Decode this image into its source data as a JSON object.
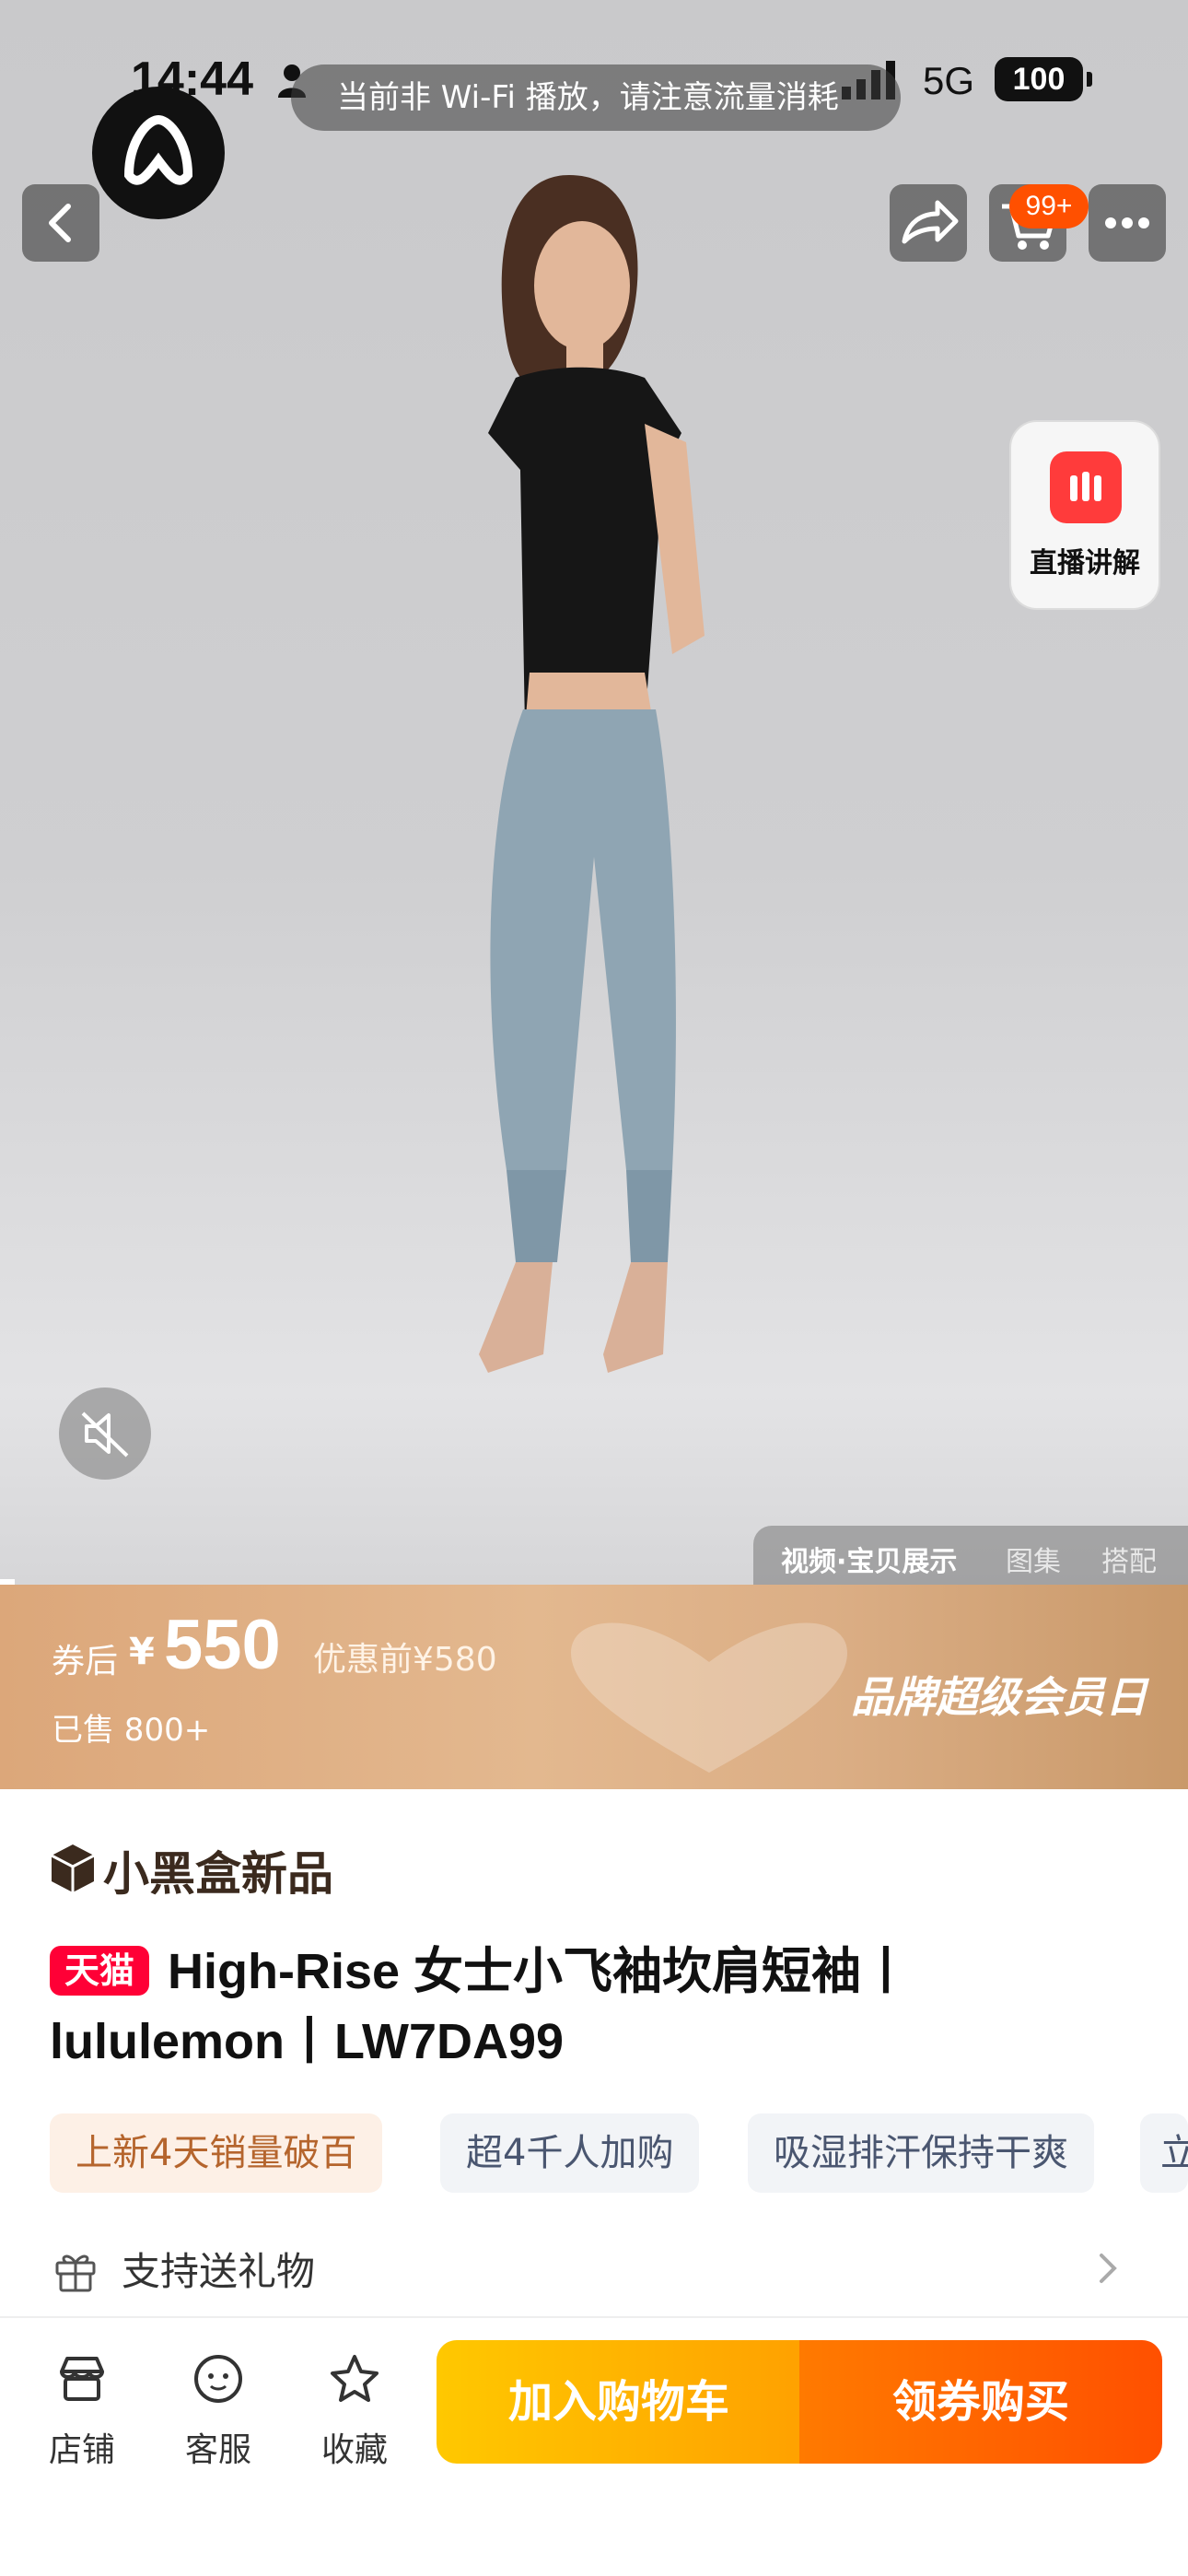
{
  "status_bar": {
    "time": "14:44",
    "network": "5G",
    "battery": "100"
  },
  "toast": {
    "text": "当前非 Wi-Fi 播放，请注意流量消耗"
  },
  "header": {
    "cart_badge": "99+"
  },
  "live": {
    "label": "直播讲解"
  },
  "media_tabs": [
    "视频·宝贝展示",
    "图集",
    "搭配"
  ],
  "price_banner": {
    "coupon_after_label": "券后",
    "currency": "¥",
    "price": "550",
    "price_before": "优惠前¥580",
    "sold": "已售 800+",
    "campaign": "品牌超级会员日",
    "colors": {
      "banner_start": "#dca77a",
      "banner_end": "#c9996a"
    }
  },
  "product": {
    "tag": "小黑盒新品",
    "platform_badge": "天猫",
    "title": "High-Rise 女士小飞袖坎肩短袖丨lululemon丨LW7DA99",
    "chips": [
      "上新4天销量破百",
      "超4千人加购",
      "吸湿排汗保持干爽",
      "立"
    ]
  },
  "gift": {
    "label": "支持送礼物"
  },
  "bottom_bar": {
    "nav": [
      "店铺",
      "客服",
      "收藏"
    ],
    "add_to_cart": "加入购物车",
    "buy_now": "领券购买"
  },
  "icons": [
    "back-icon",
    "share-icon",
    "cart-icon",
    "more-icon",
    "mute-icon",
    "store-icon",
    "service-icon",
    "star-icon",
    "gift-icon",
    "chevron-right-icon"
  ],
  "accent_color": "#ff5000",
  "tmall_color": "#ff0036"
}
